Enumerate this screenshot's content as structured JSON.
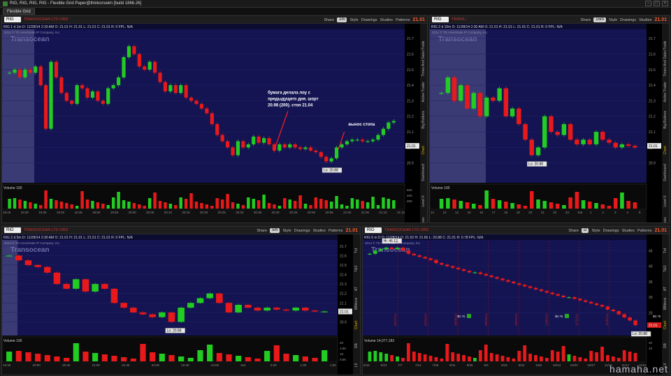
{
  "window": {
    "title": "RIG, RIG, RIG, RIG - Flexible Grid Paper@thinkorswim [build 1866.26]"
  },
  "grid_tab": "Flexible Grid",
  "toolbar": {
    "share": "Share",
    "style": "Style",
    "drawings": "Drawings",
    "studies": "Studies",
    "patterns": "Patterns"
  },
  "side_tabs_a": [
    "Trade",
    "Times And Sales",
    "Active Trader",
    "Big Buttons",
    "Chart",
    "Dashboard",
    "Level II",
    "Live News"
  ],
  "side_tabs_b": [
    "Trd",
    "T&S",
    "AT",
    "BBttons",
    "Chart",
    "DB",
    "LII",
    "News"
  ],
  "watermark": "hamaha.net",
  "panels": [
    {
      "id": "p1",
      "symbol": "RIG",
      "company": "TRANSOCEAN LTD ORD",
      "aggr": "1m",
      "last": "21.01",
      "info": "RIG 1 d 1m   D: 11/28/14 2:33 AM   O: 21.01   H: 21.01   L: 21.01   C: 21.01   R: 0   FPL: N/A",
      "copyright": "2014 © TD Ameritrade IP Company, Inc.",
      "logo": "Transocean",
      "volume_label": "Volume",
      "volume_agg": "100",
      "price_ticks": [
        "21.7",
        "21.6",
        "21.5",
        "21.4",
        "21.3",
        "21.2",
        "21.1",
        "21",
        "20.9"
      ],
      "vol_ticks": [
        "600",
        "400",
        "200"
      ],
      "time_ticks": [
        "19:25",
        "19:30",
        "19:35",
        "19:40",
        "19:45",
        "19:50",
        "19:55",
        "20:00",
        "20:05",
        "20:10",
        "20:15",
        "20:20",
        "20:25",
        "20:30",
        "20:35",
        "20:40",
        "20:45",
        "20:50",
        "20:55",
        "21:00",
        "21:05",
        "21:10",
        "21:15"
      ],
      "price_box": "21.01",
      "low_label": "Lo: 20.88",
      "ann1": [
        "бумага делала лоу  с",
        "предыдущего дня. шорт",
        "20.98 (200). стоп 21.04"
      ],
      "ann2": "вынос стопа"
    },
    {
      "id": "p2",
      "symbol": "RIG",
      "company": "TRANS...",
      "aggr": "15m",
      "last": "21.01",
      "info": "RIG 2 d 15m  D: 11/28/14 2:30 AM  O: 21.01  H: 21.01  L: 21.01  C: 21.01  R: 0  FPL: N/A",
      "copyright": "2014 © TD Ameritrade IP Company, Inc.",
      "logo": "Transocean",
      "volume_label": "Volume",
      "volume_agg": "100",
      "price_ticks": [
        "21.7",
        "21.6",
        "21.5",
        "21.4",
        "21.3",
        "21.2",
        "21.1",
        "21",
        "20.9"
      ],
      "time_ticks": [
        "12",
        "13",
        "14",
        "15",
        "16",
        "17",
        "18",
        "19",
        "20",
        "21",
        "22",
        "23",
        "Sat",
        "1",
        "2",
        "3",
        "4",
        "5"
      ],
      "price_box": "21.01",
      "low_label": "Lo: 20.88"
    },
    {
      "id": "p3",
      "symbol": "RIG",
      "company": "TRANSOCEAN LTD ORD",
      "aggr": "5m",
      "last": "21.01",
      "info": "RIG 2 d 5m   D: 11/28/14 2:30 AM   O: 21.01   H: 21.01   L: 21.01   C: 21.01   R: 0   FPL: N/A",
      "copyright": "2014 © TD Ameritrade IP Company, Inc.",
      "logo": "Transocean",
      "volume_label": "Volume",
      "volume_agg": "100",
      "price_ticks": [
        "21.7",
        "21.6",
        "21.5",
        "21.4",
        "21.3",
        "21.2",
        "21.1",
        "21",
        "20.9"
      ],
      "vol_ticks": [
        "2K",
        "1.5K",
        "1K",
        "0.5K"
      ],
      "time_ticks": [
        "19:30",
        "20:00",
        "20:30",
        "21:00",
        "21:30",
        "22:00",
        "22:30",
        "23:00",
        "Sat",
        "0:30",
        "1:00",
        "1:30"
      ],
      "time_hl": "22:20",
      "price_box": "21.01",
      "low_label": "Lo: 20.88"
    },
    {
      "id": "p4",
      "symbol": "RIG",
      "company": "TRANSOCEAN LTD ORD",
      "aggr": "D",
      "last": "21.01",
      "info": "RIG 6 m D   D: 11/28/14   O: 21.53   H: 21.66   L: 20.88   C: 21.01   R: 0.78   FPL: N/A",
      "copyright": "2014 © TD Ameritrade IP Company, Inc.",
      "logo": "Transocean",
      "volume_label": "Volume",
      "volume_agg": "14,077,183",
      "price_ticks": [
        "45",
        "40",
        "35",
        "30",
        "25"
      ],
      "vol_ticks": [
        "20",
        "10"
      ],
      "time_ticks": [
        "6/16",
        "6/23",
        "7/7",
        "7/14",
        "7/28",
        "8/11",
        "8/25",
        "9/2",
        "9/15",
        "9/22",
        "10/6",
        "10/13",
        "10/20",
        "10/27",
        "11/10",
        "11/17",
        "11/24"
      ],
      "price_box": "21.01",
      "low_label": "Lo: 20.88",
      "high_label": "Hi: 46.12",
      "events": [
        "05/27/14",
        "07/01/14",
        "08/05/14",
        "09/03/14",
        "10/07/14",
        "11/04/14",
        "11/11/14",
        "11/25/14"
      ],
      "divs": [
        "$0.75",
        "$0.75",
        "$0.75"
      ]
    }
  ],
  "chart_data": [
    {
      "type": "candlestick",
      "panel": "p1",
      "title": "RIG 1 d 1m",
      "y_range": [
        20.8,
        21.75
      ],
      "series": [
        {
          "name": "RIG",
          "close": [
            21.48,
            21.5,
            21.45,
            21.5,
            21.48,
            21.52,
            21.4,
            21.12,
            21.55,
            21.45,
            21.35,
            21.3,
            21.28,
            21.4,
            21.38,
            21.32,
            21.36,
            21.3,
            21.28,
            21.38,
            21.4,
            21.45,
            21.58,
            21.65,
            21.6,
            21.52,
            21.5,
            21.55,
            21.48,
            21.42,
            21.36,
            21.4,
            21.35,
            21.4,
            21.32,
            21.3,
            21.28,
            21.25,
            21.22,
            21.15,
            21.08,
            21.04,
            21.0,
            20.95,
            21.04,
            21.0,
            21.02,
            21.07,
            21.03,
            21.06,
            21.02,
            20.98,
            21.02,
            21.0,
            21.02,
            21.0,
            20.99,
            21.0,
            20.98,
            20.97,
            20.94,
            20.91,
            20.93,
            21.0,
            21.02,
            21.04,
            21.05,
            21.05,
            21.04,
            21.04,
            21.05,
            21.08,
            21.12,
            21.16,
            21.17
          ]
        }
      ],
      "volume": {
        "bars": 60
      }
    },
    {
      "type": "candlestick",
      "panel": "p2",
      "title": "RIG 2 d 15m",
      "y_range": [
        20.8,
        21.75
      ],
      "series": [
        {
          "name": "RIG",
          "close": [
            21.35,
            21.45,
            21.3,
            21.4,
            21.25,
            21.35,
            21.2,
            21.32,
            21.3,
            21.38,
            21.2,
            21.25,
            21.15,
            21.05,
            20.95,
            21.0,
            21.2,
            21.1,
            21.08,
            21.15,
            21.05,
            21.02,
            21.05,
            21.02,
            21.1,
            21.05,
            21.03,
            21.0,
            21.02,
            21.01,
            21.0
          ]
        }
      ]
    },
    {
      "type": "candlestick",
      "panel": "p3",
      "title": "RIG 2 d 5m",
      "y_range": [
        20.8,
        21.75
      ],
      "series": [
        {
          "name": "RIG",
          "close": [
            21.6,
            21.55,
            21.5,
            21.48,
            21.42,
            21.3,
            21.25,
            21.35,
            21.22,
            21.3,
            21.25,
            21.1,
            21.05,
            21.0,
            20.98,
            20.95,
            21.0,
            20.9,
            21.05,
            21.1,
            21.15,
            21.2,
            21.1,
            21.0,
            21.08,
            21.05,
            21.02,
            21.05,
            21.03,
            21.02,
            21.05,
            21.02,
            21.01,
            21.01
          ]
        }
      ]
    },
    {
      "type": "candlestick",
      "panel": "p4",
      "title": "RIG 6 m D",
      "y_range": [
        19,
        48
      ],
      "series": [
        {
          "name": "RIG",
          "close": [
            44,
            45,
            45.5,
            46,
            45.5,
            46,
            45,
            44,
            43.5,
            43,
            42.5,
            42,
            41,
            40.5,
            40,
            39.5,
            39,
            38.5,
            38,
            38,
            37.5,
            37,
            36.5,
            36,
            35.5,
            35,
            34.5,
            34,
            33.5,
            33,
            32.5,
            32,
            31.5,
            31,
            30.5,
            30,
            30,
            29.5,
            29,
            28.5,
            28,
            27.5,
            27,
            26,
            25.5,
            24.5,
            23.5,
            22.5,
            21
          ]
        }
      ]
    }
  ]
}
